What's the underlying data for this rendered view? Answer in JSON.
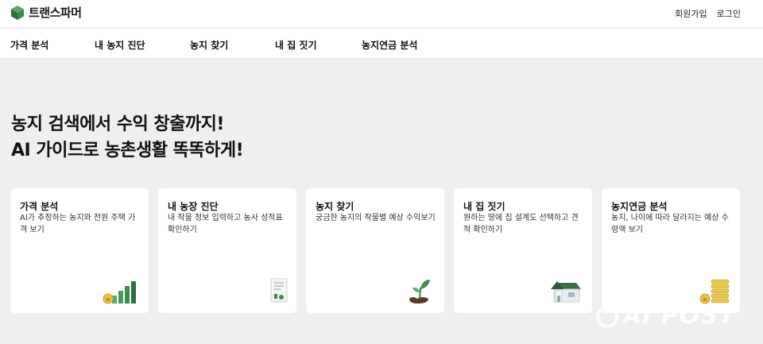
{
  "header": {
    "logo_text": "트랜스파머",
    "signup": "회원가입",
    "login": "로그인"
  },
  "nav": {
    "items": [
      "가격 분석",
      "내 농지 진단",
      "농지 찾기",
      "내 집 짓기",
      "농지연금 분석"
    ]
  },
  "hero": {
    "line1": "농지 검색에서 수익 창출까지!",
    "line2": "AI 가이드로 농촌생활 똑똑하게!"
  },
  "cards": [
    {
      "title": "가격 분석",
      "desc": "AI가 추정하는 농지와 전원 주택 가격 보기",
      "icon": "bar-chart-coin-icon"
    },
    {
      "title": "내 농장 진단",
      "desc": "내 작물 정보 입력하고 농사 성적표 확인하기",
      "icon": "report-icon"
    },
    {
      "title": "농지 찾기",
      "desc": "궁금한 농지의 작물별 예상 수익보기",
      "icon": "sprout-icon"
    },
    {
      "title": "내 집 짓기",
      "desc": "원하는 땅에 집 설계도 선택하고 견적 확인하기",
      "icon": "house-icon"
    },
    {
      "title": "농지연금 분석",
      "desc": "농지, 나이에 따라 달라지는 예상 수령액 보기",
      "icon": "coin-stack-icon"
    }
  ],
  "watermark": "AI POST",
  "colors": {
    "brand_green": "#3f8a4f",
    "background": "#efefef"
  }
}
